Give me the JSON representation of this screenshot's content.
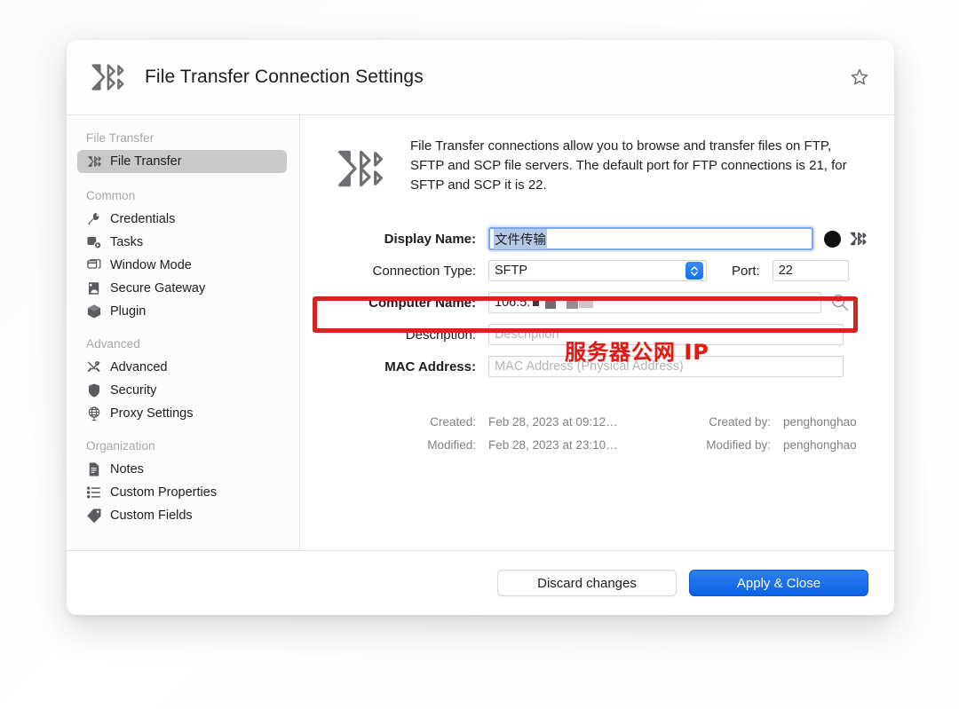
{
  "window": {
    "title": "File Transfer Connection Settings",
    "title_icon": "file-transfer-icon",
    "favorite_icon": "star-outline-icon"
  },
  "sidebar": {
    "groups": [
      {
        "title": "File Transfer",
        "items": [
          {
            "label": "File Transfer",
            "icon": "file-transfer-icon",
            "selected": true
          }
        ]
      },
      {
        "title": "Common",
        "items": [
          {
            "label": "Credentials",
            "icon": "key-icon",
            "selected": false
          },
          {
            "label": "Tasks",
            "icon": "tasks-icon",
            "selected": false
          },
          {
            "label": "Window Mode",
            "icon": "window-mode-icon",
            "selected": false
          },
          {
            "label": "Secure Gateway",
            "icon": "secure-gateway-icon",
            "selected": false
          },
          {
            "label": "Plugin",
            "icon": "plugin-cube-icon",
            "selected": false
          }
        ]
      },
      {
        "title": "Advanced",
        "items": [
          {
            "label": "Advanced",
            "icon": "tools-icon",
            "selected": false
          },
          {
            "label": "Security",
            "icon": "shield-icon",
            "selected": false
          },
          {
            "label": "Proxy Settings",
            "icon": "globe-icon",
            "selected": false
          }
        ]
      },
      {
        "title": "Organization",
        "items": [
          {
            "label": "Notes",
            "icon": "document-icon",
            "selected": false
          },
          {
            "label": "Custom Properties",
            "icon": "list-icon",
            "selected": false
          },
          {
            "label": "Custom Fields",
            "icon": "tag-icon",
            "selected": false
          }
        ]
      }
    ]
  },
  "main": {
    "intro_icon": "file-transfer-icon",
    "intro_text": "File Transfer connections allow you to browse and transfer files on FTP, SFTP and SCP file servers. The default port for FTP connections is 21, for SFTP and SCP it is 22.",
    "fields": {
      "display_name_label": "Display Name:",
      "display_name_value": "文件传输",
      "display_name_color_swatch": "#111111",
      "connection_type_label": "Connection Type:",
      "connection_type_value": "SFTP",
      "port_label": "Port:",
      "port_value": "22",
      "computer_name_label": "Computer Name:",
      "computer_name_value": "106.5.",
      "description_label": "Description:",
      "description_value": "",
      "description_placeholder": "Description",
      "mac_address_label": "MAC Address:",
      "mac_address_value": "",
      "mac_address_placeholder": "MAC Address (Physical Address)"
    },
    "meta": {
      "created_label": "Created:",
      "created_value": "Feb 28, 2023 at 09:12…",
      "created_by_label": "Created by:",
      "created_by_value": "penghonghao",
      "modified_label": "Modified:",
      "modified_value": "Feb 28, 2023 at 23:10…",
      "modified_by_label": "Modified by:",
      "modified_by_value": "penghonghao"
    }
  },
  "annotations": {
    "highlight_color": "#d8241f",
    "note_text": "服务器公网 IP",
    "note_color": "#e01b15"
  },
  "footer": {
    "discard_label": "Discard changes",
    "apply_label": "Apply & Close",
    "accent_color": "#0a62e8"
  }
}
